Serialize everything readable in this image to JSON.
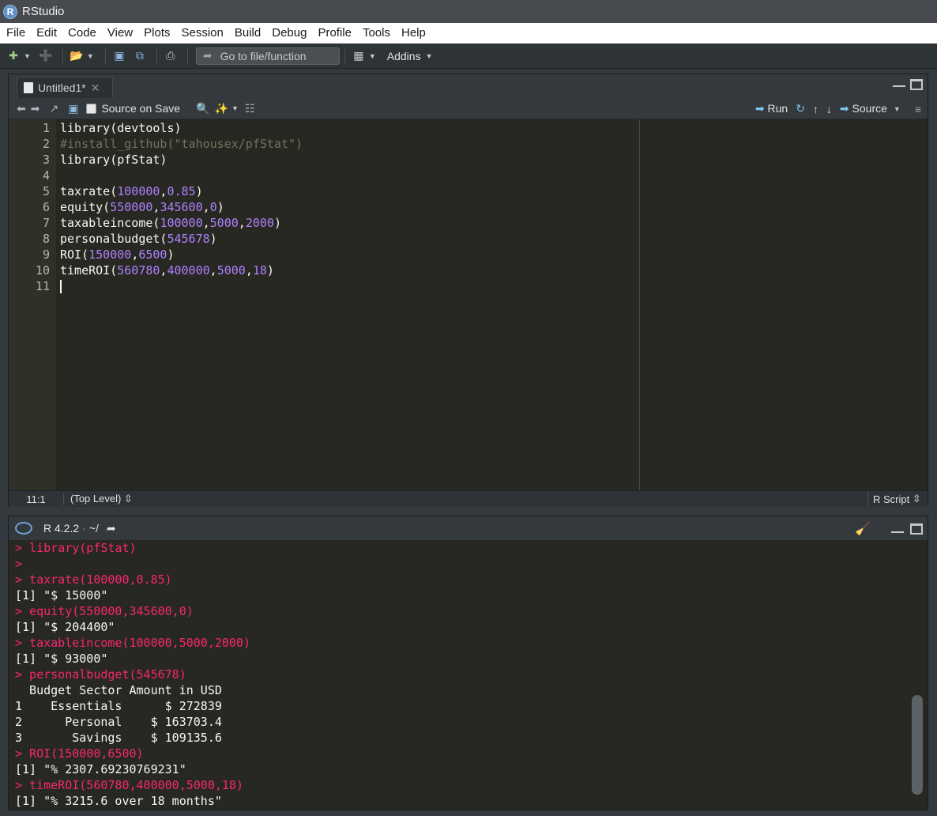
{
  "window": {
    "title": "RStudio",
    "logo_letter": "R"
  },
  "menu": [
    "File",
    "Edit",
    "Code",
    "View",
    "Plots",
    "Session",
    "Build",
    "Debug",
    "Profile",
    "Tools",
    "Help"
  ],
  "toolbar": {
    "goto_placeholder": "Go to file/function",
    "addins_label": "Addins"
  },
  "editor": {
    "tab_label": "Untitled1*",
    "source_on_save_label": "Source on Save",
    "run_label": "Run",
    "source_label": "Source",
    "line_numbers": [
      "1",
      "2",
      "3",
      "4",
      "5",
      "6",
      "7",
      "8",
      "9",
      "10",
      "11"
    ],
    "lines": [
      [
        {
          "t": "library(devtools)",
          "c": ""
        }
      ],
      [
        {
          "t": "#install_github(\"tahousex/pfStat\")",
          "c": "comment"
        }
      ],
      [
        {
          "t": "library(pfStat)",
          "c": ""
        }
      ],
      [
        {
          "t": "",
          "c": ""
        }
      ],
      [
        {
          "t": "taxrate(",
          "c": ""
        },
        {
          "t": "100000",
          "c": "num"
        },
        {
          "t": ",",
          "c": ""
        },
        {
          "t": "0.85",
          "c": "num"
        },
        {
          "t": ")",
          "c": ""
        }
      ],
      [
        {
          "t": "equity(",
          "c": ""
        },
        {
          "t": "550000",
          "c": "num"
        },
        {
          "t": ",",
          "c": ""
        },
        {
          "t": "345600",
          "c": "num"
        },
        {
          "t": ",",
          "c": ""
        },
        {
          "t": "0",
          "c": "num"
        },
        {
          "t": ")",
          "c": ""
        }
      ],
      [
        {
          "t": "taxableincome(",
          "c": ""
        },
        {
          "t": "100000",
          "c": "num"
        },
        {
          "t": ",",
          "c": ""
        },
        {
          "t": "5000",
          "c": "num"
        },
        {
          "t": ",",
          "c": ""
        },
        {
          "t": "2000",
          "c": "num"
        },
        {
          "t": ")",
          "c": ""
        }
      ],
      [
        {
          "t": "personalbudget(",
          "c": ""
        },
        {
          "t": "545678",
          "c": "num"
        },
        {
          "t": ")",
          "c": ""
        }
      ],
      [
        {
          "t": "ROI(",
          "c": ""
        },
        {
          "t": "150000",
          "c": "num"
        },
        {
          "t": ",",
          "c": ""
        },
        {
          "t": "6500",
          "c": "num"
        },
        {
          "t": ")",
          "c": ""
        }
      ],
      [
        {
          "t": "timeROI(",
          "c": ""
        },
        {
          "t": "560780",
          "c": "num"
        },
        {
          "t": ",",
          "c": ""
        },
        {
          "t": "400000",
          "c": "num"
        },
        {
          "t": ",",
          "c": ""
        },
        {
          "t": "5000",
          "c": "num"
        },
        {
          "t": ",",
          "c": ""
        },
        {
          "t": "18",
          "c": "num"
        },
        {
          "t": ")",
          "c": ""
        }
      ],
      [
        {
          "t": "",
          "c": "cursor"
        }
      ]
    ],
    "status_position": "11:1",
    "status_scope": "(Top Level)",
    "status_filetype": "R Script"
  },
  "console": {
    "version": "R 4.2.2",
    "path": "~/",
    "lines": [
      {
        "t": "> library(pfStat)",
        "k": "in"
      },
      {
        "t": ">",
        "k": "in"
      },
      {
        "t": "> taxrate(100000,0.85)",
        "k": "in"
      },
      {
        "t": "[1] \"$ 15000\"",
        "k": "out"
      },
      {
        "t": "> equity(550000,345600,0)",
        "k": "in"
      },
      {
        "t": "[1] \"$ 204400\"",
        "k": "out"
      },
      {
        "t": "> taxableincome(100000,5000,2000)",
        "k": "in"
      },
      {
        "t": "[1] \"$ 93000\"",
        "k": "out"
      },
      {
        "t": "> personalbudget(545678)",
        "k": "in"
      },
      {
        "t": "  Budget Sector Amount in USD",
        "k": "out"
      },
      {
        "t": "1    Essentials      $ 272839",
        "k": "out"
      },
      {
        "t": "2      Personal    $ 163703.4",
        "k": "out"
      },
      {
        "t": "3       Savings    $ 109135.6",
        "k": "out"
      },
      {
        "t": "> ROI(150000,6500)",
        "k": "in"
      },
      {
        "t": "[1] \"% 2307.69230769231\"",
        "k": "out"
      },
      {
        "t": "> timeROI(560780,400000,5000,18)",
        "k": "in"
      },
      {
        "t": "[1] \"% 3215.6 over 18 months\"",
        "k": "out"
      }
    ]
  }
}
